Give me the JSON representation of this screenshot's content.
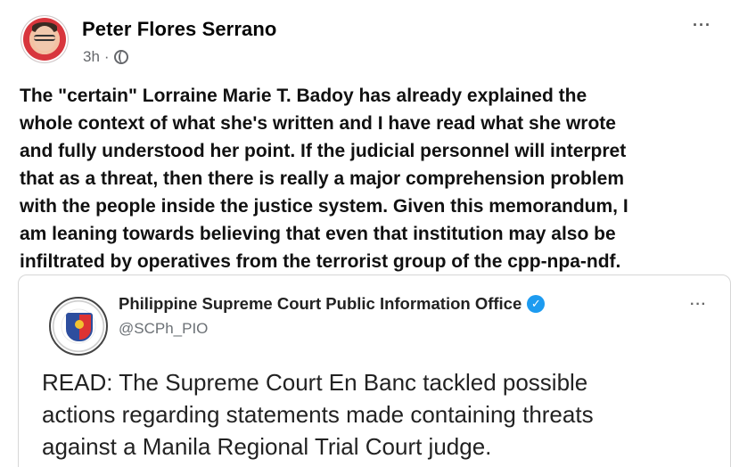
{
  "post": {
    "author": "Peter Flores Serrano",
    "time": "3h",
    "separator": "·",
    "more": "···",
    "text_lines": [
      "The \"certain\" Lorraine Marie T. Badoy has already explained the",
      "whole context  of what she's written and I have read what she wrote",
      "and fully understood her point.  If the judicial personnel will interpret",
      "that as a threat, then there is really a major comprehension problem",
      "with the people inside the justice system. Given this memorandum, I",
      "am leaning towards believing that even that institution may also be",
      "infiltrated by operatives from the terrorist group of the cpp-npa-ndf."
    ]
  },
  "shared": {
    "org_name": "Philippine Supreme Court Public Information Office",
    "handle": "@SCPh_PIO",
    "more": "···",
    "verified_glyph": "✓",
    "text_lines": [
      "READ: The Supreme Court En Banc tackled possible",
      "actions regarding statements made containing threats",
      "against a Manila Regional Trial Court judge."
    ]
  },
  "icons": {
    "avatar": "avatar",
    "globe": "globe-icon",
    "more": "more-icon",
    "seal": "seal-icon",
    "verified": "verified-icon"
  },
  "colors": {
    "verified": "#1d9bf0",
    "meta_text": "#65676b"
  }
}
